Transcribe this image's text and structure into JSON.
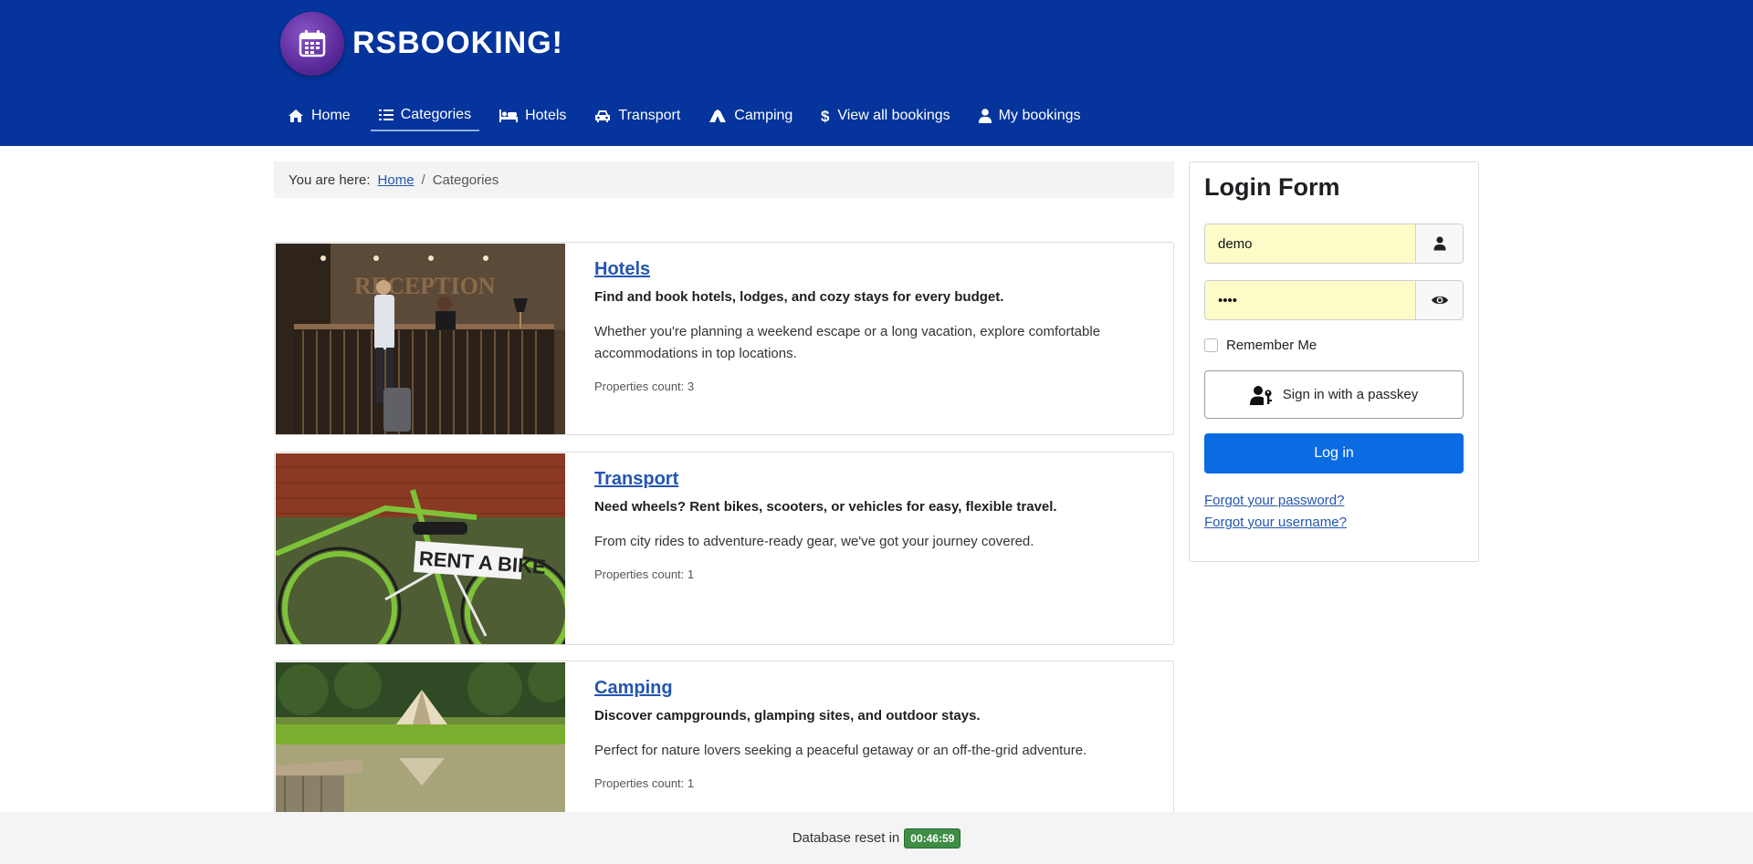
{
  "brand": {
    "name": "RSBOOKING!"
  },
  "nav": {
    "items": [
      {
        "label": "Home",
        "icon": "home-icon"
      },
      {
        "label": "Categories",
        "icon": "list-icon"
      },
      {
        "label": "Hotels",
        "icon": "bed-icon"
      },
      {
        "label": "Transport",
        "icon": "car-icon"
      },
      {
        "label": "Camping",
        "icon": "tent-icon"
      },
      {
        "label": "View all bookings",
        "icon": "dollar-icon"
      },
      {
        "label": "My bookings",
        "icon": "user-icon"
      }
    ],
    "active": "Categories"
  },
  "breadcrumb": {
    "prefix": "You are here:",
    "home": "Home",
    "separator": "/",
    "current": "Categories"
  },
  "categories": [
    {
      "title": "Hotels",
      "lead": "Find and book hotels, lodges, and cozy stays for every budget.",
      "desc": "Whether you're planning a weekend escape or a long vacation, explore comfortable accommodations in top locations.",
      "count": "Properties count: 3",
      "image_text": "RECEPTION"
    },
    {
      "title": "Transport",
      "lead": "Need wheels? Rent bikes, scooters, or vehicles for easy, flexible travel.",
      "desc": "From city rides to adventure-ready gear, we've got your journey covered.",
      "count": "Properties count: 1",
      "image_text": "RENT A BIKE"
    },
    {
      "title": "Camping",
      "lead": "Discover campgrounds, glamping sites, and outdoor stays.",
      "desc": "Perfect for nature lovers seeking a peaceful getaway or an off-the-grid adventure.",
      "count": "Properties count: 1"
    }
  ],
  "login": {
    "title": "Login Form",
    "username": "demo",
    "password": "••••",
    "remember": "Remember Me",
    "passkey": "Sign in with a passkey",
    "submit": "Log in",
    "forgot_password": "Forgot your password?",
    "forgot_username": "Forgot your username?"
  },
  "footer": {
    "text": "Database reset in",
    "timer": "00:46:59"
  },
  "colors": {
    "header": "#04349c",
    "link": "#2456b0",
    "primary": "#0a6be3",
    "badge": "#3e8e44"
  }
}
